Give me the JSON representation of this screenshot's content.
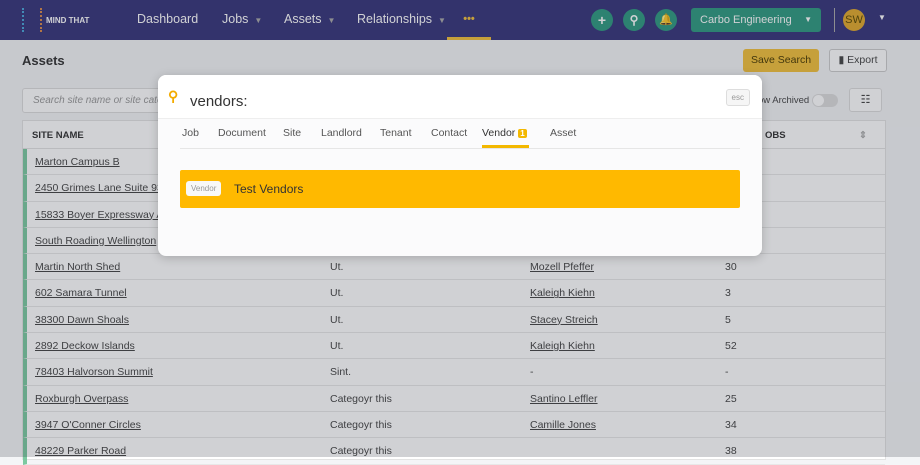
{
  "nav": {
    "logo": "MIND THAT",
    "items": [
      "Dashboard",
      "Jobs",
      "Assets",
      "Relationships"
    ],
    "more": "•••",
    "company": "Carbo Engineering",
    "avatar": "SW"
  },
  "page": {
    "title": "Assets",
    "save_search": "Save Search",
    "export": "Export",
    "search_placeholder": "Search site name or site categ",
    "show_archived": "ow Archived"
  },
  "table": {
    "headers": [
      "SITE NAME",
      "OBS"
    ],
    "rows": [
      [
        "Marton Campus B",
        "",
        "",
        ""
      ],
      [
        "2450 Grimes Lane Suite 931",
        "",
        "",
        ""
      ],
      [
        "15833 Boyer Expressway Ap",
        "",
        "",
        ""
      ],
      [
        "South Roading Wellington",
        "",
        "",
        ""
      ],
      [
        "Martin North Shed",
        "Ut.",
        "Mozell Pfeffer",
        "30"
      ],
      [
        "602 Samara Tunnel",
        "Ut.",
        "Kaleigh Kiehn",
        "3"
      ],
      [
        "38300 Dawn Shoals",
        "Ut.",
        "Stacey Streich",
        "5"
      ],
      [
        "2892 Deckow Islands",
        "Ut.",
        "Kaleigh Kiehn",
        "52"
      ],
      [
        "78403 Halvorson Summit",
        "Sint.",
        "-",
        "-"
      ],
      [
        "Roxburgh Overpass",
        "Categoyr this",
        "Santino Leffler",
        "25"
      ],
      [
        "3947 O'Conner Circles",
        "Categoyr this",
        "Camille Jones",
        "34"
      ],
      [
        "48229 Parker Road",
        "Categoyr this",
        "",
        "38"
      ]
    ]
  },
  "modal": {
    "query": "vendors:",
    "esc": "esc",
    "tabs": [
      "Job",
      "Document",
      "Site",
      "Landlord",
      "Tenant",
      "Contact",
      "Vendor",
      "Asset"
    ],
    "vendor_count": "1",
    "result": {
      "tag": "Vendor",
      "text": "Test Vendors"
    }
  }
}
